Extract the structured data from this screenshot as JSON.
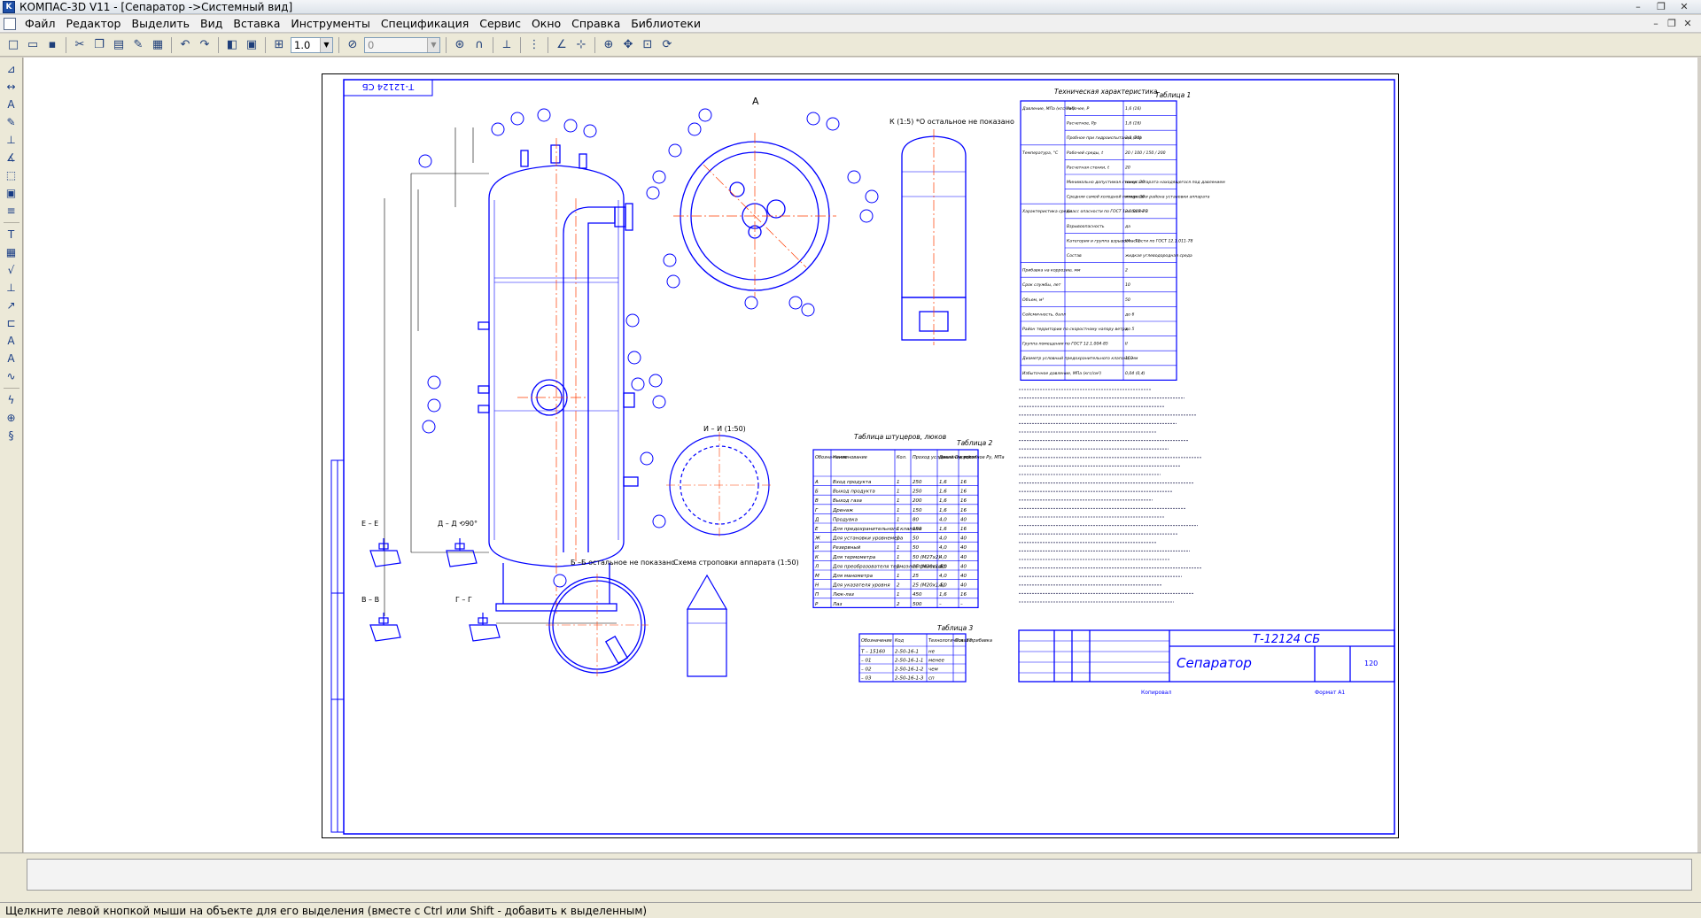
{
  "window": {
    "title": "КОМПАС-3D V11 - [Сепаратор ->Системный вид]",
    "controls": {
      "minimize": "–",
      "restore": "❐",
      "close": "✕"
    }
  },
  "menu": {
    "items": [
      "Файл",
      "Редактор",
      "Выделить",
      "Вид",
      "Вставка",
      "Инструменты",
      "Спецификация",
      "Сервис",
      "Окно",
      "Справка",
      "Библиотеки"
    ],
    "mdi_controls": {
      "minimize": "–",
      "restore": "❐",
      "close": "✕"
    }
  },
  "toolbar": {
    "scale_value": "1.0",
    "layer_value": "0"
  },
  "drawing": {
    "stamp_code": "Т-12124 СБ",
    "stamp_title": "Сепаратор",
    "rotated_code": "Т-12124 СБ",
    "view_label_a": "А",
    "view_label_k": "К (1:5) *О остальное не показано",
    "section_ee": "Е – Е",
    "section_dd": "Д – Д  ⟲90°",
    "section_vv": "В – В",
    "section_gg": "Г – Г",
    "section_bb": "Б –Б остальное не показано",
    "section_ii": "И – И (1:50)",
    "sling_scheme": "Схема строповки аппарата (1:50)",
    "table1_caption": "Техническая характеристика",
    "table1_label": "Таблица 1",
    "table2_caption": "Таблица штуцеров, люков",
    "table2_label": "Таблица 2",
    "table3_label": "Таблица 3",
    "mass_value": "120",
    "format_label": "Формат  А1",
    "copy_label": "Копировал"
  },
  "table2": {
    "headers": [
      "Обозна-чение",
      "Наименование",
      "Кол.",
      "Проход условный Dу, мм",
      "Давление условное Ру, МПа",
      "кгс/см²"
    ],
    "rows": [
      [
        "А",
        "Вход продукта",
        "1",
        "250",
        "1,6",
        "16"
      ],
      [
        "Б",
        "Выход продукта",
        "1",
        "250",
        "1,6",
        "16"
      ],
      [
        "В",
        "Выход газа",
        "1",
        "200",
        "1,6",
        "16"
      ],
      [
        "Г",
        "Дренаж",
        "1",
        "150",
        "1,6",
        "16"
      ],
      [
        "Д",
        "Продувка",
        "1",
        "80",
        "4,0",
        "40"
      ],
      [
        "Е",
        "Для предохранительного клапана",
        "1",
        "150",
        "1,6",
        "16"
      ],
      [
        "Ж",
        "Для установки уровнемера",
        "1",
        "50",
        "4,0",
        "40"
      ],
      [
        "И",
        "Резервный",
        "1",
        "50",
        "4,0",
        "40"
      ],
      [
        "К",
        "Для термометра",
        "1",
        "50 (М27х2)",
        "4,0",
        "40"
      ],
      [
        "Л",
        "Для преобразователя термоэлектрического",
        "1",
        "25 (М20х1,5)",
        "4,0",
        "40"
      ],
      [
        "М",
        "Для манометра",
        "1",
        "25",
        "4,0",
        "40"
      ],
      [
        "Н",
        "Для указателя уровня",
        "2",
        "25 (М20х1,5)",
        "4,0",
        "40"
      ],
      [
        "П",
        "Люк-лаз",
        "1",
        "450",
        "1,6",
        "16"
      ],
      [
        "Р",
        "Лаз",
        "2",
        "500",
        "–",
        "–"
      ]
    ]
  },
  "table3": {
    "headers": [
      "Обозначение",
      "Код",
      "Технологическая прибавка",
      "Поз. 38"
    ],
    "rows": [
      [
        "Т – 15160",
        "2-50-16-1",
        "не",
        ""
      ],
      [
        "– 01",
        "2-50-16-1-1",
        "менее",
        ""
      ],
      [
        "– 02",
        "2-50-16-1-2",
        "чем",
        ""
      ],
      [
        "– 03",
        "2-50-16-1-3",
        "сп",
        ""
      ]
    ]
  },
  "table1": {
    "rows": [
      [
        "Давление, МПа (кгс/см²)",
        "Рабочее, Р",
        "1,6 (16)"
      ],
      [
        "",
        "Расчетное, Рр",
        "1,6 (16)"
      ],
      [
        "",
        "Пробное при гидроиспытании, Рпр",
        "2,0 (20)"
      ],
      [
        "Температура, °С",
        "Рабочей среды, t",
        "20 / 100 / 150 / 200"
      ],
      [
        "",
        "Расчетная стенки, t",
        "20"
      ],
      [
        "",
        "Минимально допустимая стенки аппарата находящегося под давлением",
        "минус 30"
      ],
      [
        "",
        "Средняя самой холодной пятидневки района установки аппарата",
        "минус 30"
      ],
      [
        "Характеристика среды",
        "Класс опасности по ГОСТ 12.1.007-76",
        "не более 3"
      ],
      [
        "",
        "Взрывоопасность",
        "да"
      ],
      [
        "",
        "Категория и группа взрывоопасности по ГОСТ 12.1.011-78",
        "IIА – Т3"
      ],
      [
        "",
        "Состав",
        "жидкая углеводородная среда"
      ],
      [
        "Прибавка на коррозию, мм",
        "",
        "2"
      ],
      [
        "Срок службы, лет",
        "",
        "10"
      ],
      [
        "Объем, м³",
        "",
        "50"
      ],
      [
        "Сейсмичность, балл",
        "",
        "до 6"
      ],
      [
        "Район территории по скоростному напору ветра",
        "",
        "до 5"
      ],
      [
        "Группа помещения по ГОСТ 12.1.004-85",
        "",
        "II"
      ],
      [
        "Диаметр условный предохранительного клапана, мм",
        "",
        "150"
      ],
      [
        "Избыточное давление, МПа (кгс/см²)",
        "",
        "0,04 (0,4)"
      ]
    ]
  },
  "notes_lines": 26,
  "status": {
    "message": "Щелкните левой кнопкой мыши на объекте для его выделения (вместе с Ctrl или Shift - добавить к выделенным)"
  },
  "colors": {
    "drawing_line": "#0000ff",
    "axis_line": "#ff3b00",
    "dimension_line": "#000000",
    "workspace_bg": "#ffffff",
    "chrome_bg": "#ece9d8"
  },
  "icons": [
    "new-icon",
    "open-icon",
    "save-icon",
    "cut-icon",
    "copy-icon",
    "paste-icon",
    "undo-icon",
    "redo-icon",
    "zoom-icon",
    "pan-icon"
  ]
}
